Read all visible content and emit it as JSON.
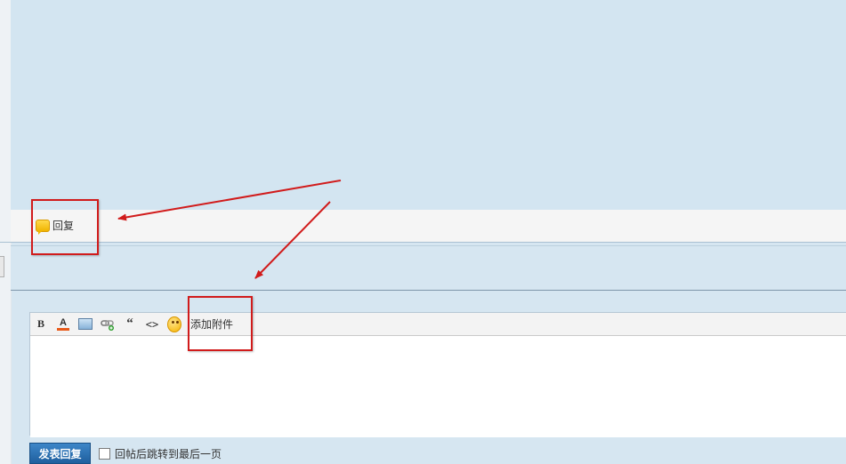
{
  "reply_bar": {
    "reply_label": "回复",
    "icon": "speech-bubble-icon"
  },
  "editor": {
    "toolbar": [
      {
        "name": "bold-button",
        "label": "B",
        "icon": "bold-icon"
      },
      {
        "name": "font-color-button",
        "label": "A",
        "icon": "font-color-icon"
      },
      {
        "name": "image-button",
        "icon": "image-icon"
      },
      {
        "name": "link-button",
        "icon": "link-icon"
      },
      {
        "name": "quote-button",
        "label": "“",
        "icon": "quote-icon"
      },
      {
        "name": "code-button",
        "label": "<>",
        "icon": "code-icon"
      },
      {
        "name": "emoji-button",
        "icon": "smiley-icon"
      }
    ],
    "attach_label": "添加附件"
  },
  "submit": {
    "button_label": "发表回复",
    "checkbox_label": "回帖后跳转到最后一页",
    "checked": false
  },
  "colors": {
    "page_bg": "#d6e6f1",
    "button_blue": "#2a6fb2",
    "annotation_red": "#d11b1b",
    "accent_color_bar": "#e85a1a"
  }
}
